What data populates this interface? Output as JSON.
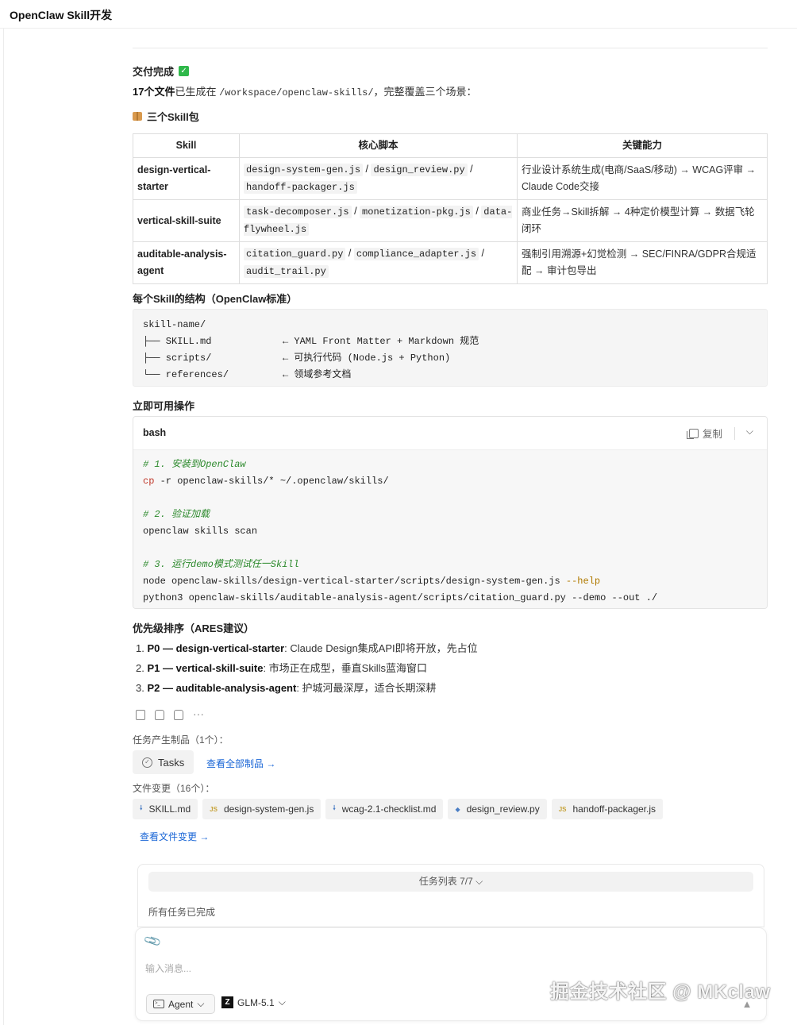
{
  "window": {
    "title": "OpenClaw Skill开发"
  },
  "delivery": {
    "heading": "交付完成",
    "summary_count": "17个文件",
    "summary_text_1": "已生成在",
    "summary_path": "/workspace/openclaw-skills/",
    "summary_text_2": "，完整覆盖三个场景："
  },
  "packages": {
    "heading": "三个Skill包",
    "columns": [
      "Skill",
      "核心脚本",
      "关键能力"
    ],
    "rows": [
      {
        "name": "design-vertical-starter",
        "scripts": [
          "design-system-gen.js",
          "design_review.py",
          "handoff-packager.js"
        ],
        "capability": "行业设计系统生成(电商/SaaS/移动) → WCAG评审 → Claude Code交接"
      },
      {
        "name": "vertical-skill-suite",
        "scripts": [
          "task-decomposer.js",
          "monetization-pkg.js",
          "data-flywheel.js"
        ],
        "capability": "商业任务→Skill拆解 → 4种定价模型计算 → 数据飞轮闭环"
      },
      {
        "name": "auditable-analysis-agent",
        "scripts": [
          "citation_guard.py",
          "compliance_adapter.js",
          "audit_trail.py"
        ],
        "capability": "强制引用溯源+幻觉检测 → SEC/FINRA/GDPR合规适配 → 审计包导出"
      }
    ]
  },
  "structure": {
    "heading": "每个Skill的结构（OpenClaw标准）",
    "lines": [
      {
        "left": "skill-name/",
        "right": ""
      },
      {
        "left": "├── SKILL.md",
        "right": "← YAML Front Matter + Markdown 规范"
      },
      {
        "left": "├── scripts/",
        "right": "← 可执行代码 (Node.js + Python)"
      },
      {
        "left": "└── references/",
        "right": "← 领域参考文档"
      }
    ]
  },
  "operations": {
    "heading": "立即可用操作",
    "lang": "bash",
    "copy_label": "复制",
    "code": {
      "c1": "# 1. 安装到OpenClaw",
      "l1_cmd": "cp",
      "l1_rest": " -r openclaw-skills/* ~/.openclaw/skills/",
      "c2": "# 2. 验证加载",
      "l2": "openclaw skills scan",
      "c3": "# 3. 运行demo模式测试任一Skill",
      "l3_rest": "node openclaw-skills/design-vertical-starter/scripts/design-system-gen.js ",
      "l3_flag": "--help",
      "l4": "python3 openclaw-skills/auditable-analysis-agent/scripts/citation_guard.py --demo --out ./"
    }
  },
  "priority": {
    "heading": "优先级排序（ARES建议）",
    "items": [
      {
        "num": "1.",
        "level": "P0",
        "name": "design-vertical-starter",
        "desc": ": Claude Design集成API即将开放，先占位"
      },
      {
        "num": "2.",
        "level": "P1",
        "name": "vertical-skill-suite",
        "desc": ": 市场正在成型，垂直Skills蓝海窗口"
      },
      {
        "num": "3.",
        "level": "P2",
        "name": "auditable-analysis-agent",
        "desc": ": 护城河最深厚，适合长期深耕"
      }
    ],
    "dash": " — "
  },
  "artifacts": {
    "label": "任务产生制品（1个）：",
    "tasks_label": "Tasks",
    "view_all": "查看全部制品 →"
  },
  "changes": {
    "label": "文件变更（16个）：",
    "files": [
      {
        "name": "SKILL.md",
        "type": "md",
        "icon": "download-icon",
        "glyph": "🠗"
      },
      {
        "name": "design-system-gen.js",
        "type": "js",
        "icon": "js-file-icon",
        "glyph": "JS"
      },
      {
        "name": "wcag-2.1-checklist.md",
        "type": "md",
        "icon": "download-icon",
        "glyph": "🠗"
      },
      {
        "name": "design_review.py",
        "type": "py",
        "icon": "python-file-icon",
        "glyph": "◆"
      },
      {
        "name": "handoff-packager.js",
        "type": "js",
        "icon": "js-file-icon",
        "glyph": "JS"
      }
    ],
    "view_changes": "查看文件变更 →"
  },
  "task_panel": {
    "bar_label": "任务列表 7/7",
    "status": "所有任务已完成"
  },
  "composer": {
    "placeholder": "输入消息...",
    "agent_label": "Agent",
    "model_label": "GLM-5.1"
  },
  "watermark": "掘金技术社区 @ MKclaw"
}
